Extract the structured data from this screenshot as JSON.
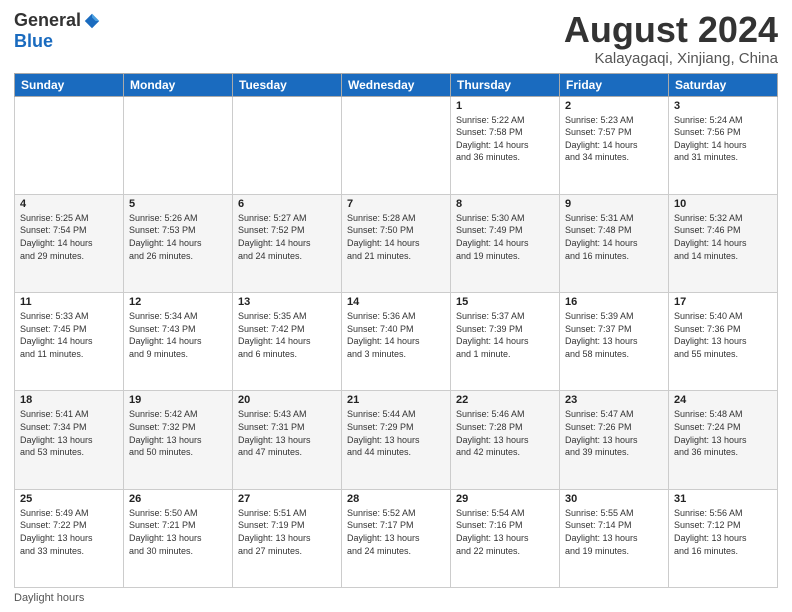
{
  "header": {
    "logo_general": "General",
    "logo_blue": "Blue",
    "month_title": "August 2024",
    "location": "Kalayagaqi, Xinjiang, China"
  },
  "days_of_week": [
    "Sunday",
    "Monday",
    "Tuesday",
    "Wednesday",
    "Thursday",
    "Friday",
    "Saturday"
  ],
  "weeks": [
    [
      {
        "day": "",
        "info": ""
      },
      {
        "day": "",
        "info": ""
      },
      {
        "day": "",
        "info": ""
      },
      {
        "day": "",
        "info": ""
      },
      {
        "day": "1",
        "info": "Sunrise: 5:22 AM\nSunset: 7:58 PM\nDaylight: 14 hours\nand 36 minutes."
      },
      {
        "day": "2",
        "info": "Sunrise: 5:23 AM\nSunset: 7:57 PM\nDaylight: 14 hours\nand 34 minutes."
      },
      {
        "day": "3",
        "info": "Sunrise: 5:24 AM\nSunset: 7:56 PM\nDaylight: 14 hours\nand 31 minutes."
      }
    ],
    [
      {
        "day": "4",
        "info": "Sunrise: 5:25 AM\nSunset: 7:54 PM\nDaylight: 14 hours\nand 29 minutes."
      },
      {
        "day": "5",
        "info": "Sunrise: 5:26 AM\nSunset: 7:53 PM\nDaylight: 14 hours\nand 26 minutes."
      },
      {
        "day": "6",
        "info": "Sunrise: 5:27 AM\nSunset: 7:52 PM\nDaylight: 14 hours\nand 24 minutes."
      },
      {
        "day": "7",
        "info": "Sunrise: 5:28 AM\nSunset: 7:50 PM\nDaylight: 14 hours\nand 21 minutes."
      },
      {
        "day": "8",
        "info": "Sunrise: 5:30 AM\nSunset: 7:49 PM\nDaylight: 14 hours\nand 19 minutes."
      },
      {
        "day": "9",
        "info": "Sunrise: 5:31 AM\nSunset: 7:48 PM\nDaylight: 14 hours\nand 16 minutes."
      },
      {
        "day": "10",
        "info": "Sunrise: 5:32 AM\nSunset: 7:46 PM\nDaylight: 14 hours\nand 14 minutes."
      }
    ],
    [
      {
        "day": "11",
        "info": "Sunrise: 5:33 AM\nSunset: 7:45 PM\nDaylight: 14 hours\nand 11 minutes."
      },
      {
        "day": "12",
        "info": "Sunrise: 5:34 AM\nSunset: 7:43 PM\nDaylight: 14 hours\nand 9 minutes."
      },
      {
        "day": "13",
        "info": "Sunrise: 5:35 AM\nSunset: 7:42 PM\nDaylight: 14 hours\nand 6 minutes."
      },
      {
        "day": "14",
        "info": "Sunrise: 5:36 AM\nSunset: 7:40 PM\nDaylight: 14 hours\nand 3 minutes."
      },
      {
        "day": "15",
        "info": "Sunrise: 5:37 AM\nSunset: 7:39 PM\nDaylight: 14 hours\nand 1 minute."
      },
      {
        "day": "16",
        "info": "Sunrise: 5:39 AM\nSunset: 7:37 PM\nDaylight: 13 hours\nand 58 minutes."
      },
      {
        "day": "17",
        "info": "Sunrise: 5:40 AM\nSunset: 7:36 PM\nDaylight: 13 hours\nand 55 minutes."
      }
    ],
    [
      {
        "day": "18",
        "info": "Sunrise: 5:41 AM\nSunset: 7:34 PM\nDaylight: 13 hours\nand 53 minutes."
      },
      {
        "day": "19",
        "info": "Sunrise: 5:42 AM\nSunset: 7:32 PM\nDaylight: 13 hours\nand 50 minutes."
      },
      {
        "day": "20",
        "info": "Sunrise: 5:43 AM\nSunset: 7:31 PM\nDaylight: 13 hours\nand 47 minutes."
      },
      {
        "day": "21",
        "info": "Sunrise: 5:44 AM\nSunset: 7:29 PM\nDaylight: 13 hours\nand 44 minutes."
      },
      {
        "day": "22",
        "info": "Sunrise: 5:46 AM\nSunset: 7:28 PM\nDaylight: 13 hours\nand 42 minutes."
      },
      {
        "day": "23",
        "info": "Sunrise: 5:47 AM\nSunset: 7:26 PM\nDaylight: 13 hours\nand 39 minutes."
      },
      {
        "day": "24",
        "info": "Sunrise: 5:48 AM\nSunset: 7:24 PM\nDaylight: 13 hours\nand 36 minutes."
      }
    ],
    [
      {
        "day": "25",
        "info": "Sunrise: 5:49 AM\nSunset: 7:22 PM\nDaylight: 13 hours\nand 33 minutes."
      },
      {
        "day": "26",
        "info": "Sunrise: 5:50 AM\nSunset: 7:21 PM\nDaylight: 13 hours\nand 30 minutes."
      },
      {
        "day": "27",
        "info": "Sunrise: 5:51 AM\nSunset: 7:19 PM\nDaylight: 13 hours\nand 27 minutes."
      },
      {
        "day": "28",
        "info": "Sunrise: 5:52 AM\nSunset: 7:17 PM\nDaylight: 13 hours\nand 24 minutes."
      },
      {
        "day": "29",
        "info": "Sunrise: 5:54 AM\nSunset: 7:16 PM\nDaylight: 13 hours\nand 22 minutes."
      },
      {
        "day": "30",
        "info": "Sunrise: 5:55 AM\nSunset: 7:14 PM\nDaylight: 13 hours\nand 19 minutes."
      },
      {
        "day": "31",
        "info": "Sunrise: 5:56 AM\nSunset: 7:12 PM\nDaylight: 13 hours\nand 16 minutes."
      }
    ]
  ],
  "footer": {
    "note": "Daylight hours"
  }
}
